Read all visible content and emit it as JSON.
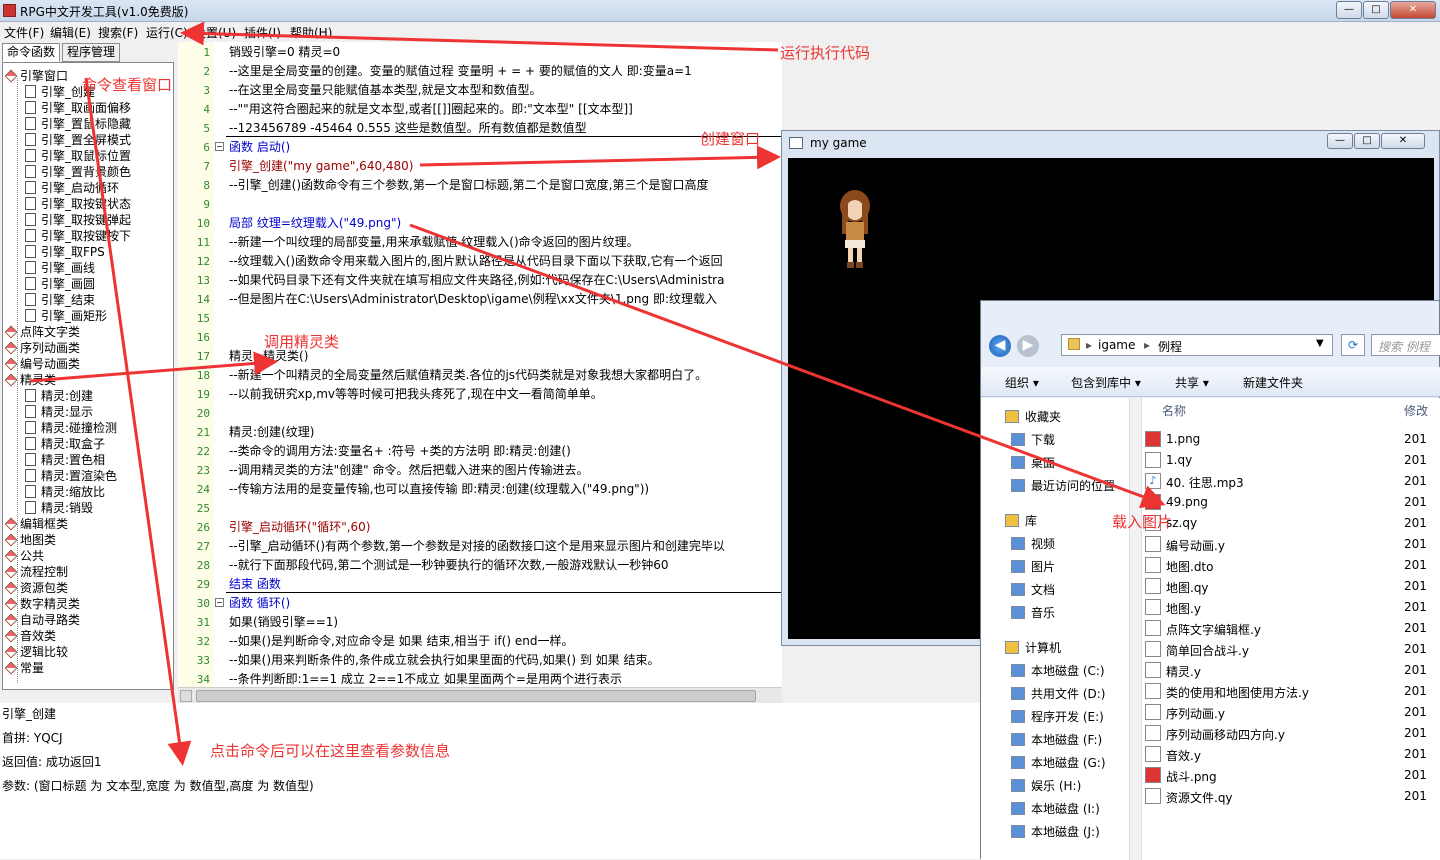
{
  "app": {
    "title": "RPG中文开发工具(v1.0免费版)"
  },
  "window_buttons": {
    "minimize": "—",
    "maximize": "□",
    "close": "✕"
  },
  "menu": [
    "文件(F)",
    "编辑(E)",
    "搜索(F)",
    "运行(C)",
    "设置(U)",
    "插件(I)",
    "帮助(H)"
  ],
  "tabs": [
    "命令函数",
    "程序管理"
  ],
  "tree": [
    {
      "label": "引擎窗口",
      "level": 0
    },
    {
      "label": "引擎_创建",
      "level": 1
    },
    {
      "label": "引擎_取画面偏移",
      "level": 1
    },
    {
      "label": "引擎_置鼠标隐藏",
      "level": 1
    },
    {
      "label": "引擎_置全屏模式",
      "level": 1
    },
    {
      "label": "引擎_取鼠标位置",
      "level": 1
    },
    {
      "label": "引擎_置背景颜色",
      "level": 1
    },
    {
      "label": "引擎_启动循环",
      "level": 1
    },
    {
      "label": "引擎_取按键状态",
      "level": 1
    },
    {
      "label": "引擎_取按键弹起",
      "level": 1
    },
    {
      "label": "引擎_取按键按下",
      "level": 1
    },
    {
      "label": "引擎_取FPS",
      "level": 1
    },
    {
      "label": "引擎_画线",
      "level": 1
    },
    {
      "label": "引擎_画圆",
      "level": 1
    },
    {
      "label": "引擎_结束",
      "level": 1
    },
    {
      "label": "引擎_画矩形",
      "level": 1
    },
    {
      "label": "点阵文字类",
      "level": 0
    },
    {
      "label": "序列动画类",
      "level": 0
    },
    {
      "label": "编号动画类",
      "level": 0
    },
    {
      "label": "精灵类",
      "level": 0
    },
    {
      "label": "精灵:创建",
      "level": 1
    },
    {
      "label": "精灵:显示",
      "level": 1
    },
    {
      "label": "精灵:碰撞检测",
      "level": 1
    },
    {
      "label": "精灵:取盒子",
      "level": 1
    },
    {
      "label": "精灵:置色相",
      "level": 1
    },
    {
      "label": "精灵:置渲染色",
      "level": 1
    },
    {
      "label": "精灵:缩放比",
      "level": 1
    },
    {
      "label": "精灵:销毁",
      "level": 1
    },
    {
      "label": "编辑框类",
      "level": 0
    },
    {
      "label": "地图类",
      "level": 0
    },
    {
      "label": "公共",
      "level": 0
    },
    {
      "label": "流程控制",
      "level": 0
    },
    {
      "label": "资源包类",
      "level": 0
    },
    {
      "label": "数字精灵类",
      "level": 0
    },
    {
      "label": "自动寻路类",
      "level": 0
    },
    {
      "label": "音效类",
      "level": 0
    },
    {
      "label": "逻辑比较",
      "level": 0
    },
    {
      "label": "常量",
      "level": 0
    }
  ],
  "code": [
    "销毁引擎=0 精灵=0",
    "--这里是全局变量的创建。变量的赋值过程 变量明 + = + 要的赋值的文人 即:变量a=1",
    "--在这里全局变量只能赋值基本类型,就是文本型和数值型。",
    "--\"\"用这符合圈起来的就是文本型,或者[[]]圈起来的。即:\"文本型\" [[文本型]]",
    "--123456789 -45464 0.555 这些是数值型。所有数值都是数值型",
    "函数 启动()",
    "引擎_创建(\"my game\",640,480)",
    "--引擎_创建()函数命令有三个参数,第一个是窗口标题,第二个是窗口宽度,第三个是窗口高度",
    "",
    "局部 纹理=纹理载入(\"49.png\")",
    "--新建一个叫纹理的局部变量,用来承载赋值 纹理载入()命令返回的图片纹理。",
    "--纹理载入()函数命令用来载入图片的,图片默认路径是从代码目录下面以下获取,它有一个返回",
    "--如果代码目录下还有文件夹就在填写相应文件夹路径,例如:代码保存在C:\\Users\\Administra",
    "--但是图片在C:\\Users\\Administrator\\Desktop\\igame\\例程\\xx文件夹\\1.png  即:纹理载入",
    "",
    "",
    "精灵=精灵类()",
    "--新建一个叫精灵的全局变量然后赋值精灵类.各位的js代码类就是对象我想大家都明白了。",
    "--以前我研究xp,mv等等时候可把我头疼死了,现在中文一看简简单单。",
    "",
    "精灵:创建(纹理)",
    "--类命令的调用方法:变量名+ :符号 +类的方法明 即:精灵:创建()",
    "--调用精灵类的方法\"创建\" 命令。然后把载入进来的图片传输进去。",
    "--传输方法用的是变量传输,也可以直接传输 即:精灵:创建(纹理载入(\"49.png\"))",
    "",
    "引擎_启动循环(\"循环\",60)",
    "--引擎_启动循环()有两个参数,第一个参数是对接的函数接口这个是用来显示图片和创建完毕以",
    "--就行下面那段代码,第二个测试是一秒钟要执行的循环次数,一般游戏默认一秒钟60",
    "结束 函数",
    "函数 循环()",
    "    如果(销毁引擎==1)",
    "     --如果()是判断命令,对应命令是 如果 结束,相当于 if() end一样。",
    "     --如果()用来判断条件的,条件成立就会执行如果里面的代码,如果() 到 如果 结束。",
    "     --条件判断即:1==1 成立  2==1不成立 如果里面两个=是用两个进行表示"
  ],
  "info": {
    "name": "引擎_创建",
    "pinyin": "首拼: YQCJ",
    "returns": "返回值: 成功返回1",
    "params": "参数: (窗口标题 为 文本型,宽度 为 数值型,高度 为 数值型)"
  },
  "game_window": {
    "title": "my game"
  },
  "explorer": {
    "path": [
      "igame",
      "例程"
    ],
    "search_placeholder": "搜索 例程",
    "toolbar": [
      "组织 ▾",
      "包含到库中 ▾",
      "共享 ▾",
      "新建文件夹"
    ],
    "column_name": "名称",
    "column_date": "修改",
    "nav": [
      {
        "label": "收藏夹",
        "group": true
      },
      {
        "label": "下载"
      },
      {
        "label": "桌面"
      },
      {
        "label": "最近访问的位置"
      },
      {
        "label": "库",
        "group": true
      },
      {
        "label": "视频"
      },
      {
        "label": "图片"
      },
      {
        "label": "文档"
      },
      {
        "label": "音乐"
      },
      {
        "label": "计算机",
        "group": true
      },
      {
        "label": "本地磁盘 (C:)"
      },
      {
        "label": "共用文件 (D:)"
      },
      {
        "label": "程序开发 (E:)"
      },
      {
        "label": "本地磁盘 (F:)"
      },
      {
        "label": "本地磁盘 (G:)"
      },
      {
        "label": "娱乐 (H:)"
      },
      {
        "label": "本地磁盘 (I:)"
      },
      {
        "label": "本地磁盘 (J:)"
      }
    ],
    "files": [
      {
        "name": "1.png",
        "type": "png",
        "date": "201"
      },
      {
        "name": "1.qy",
        "type": "doc",
        "date": "201"
      },
      {
        "name": "40. 往思.mp3",
        "type": "music",
        "date": "201"
      },
      {
        "name": "49.png",
        "type": "png",
        "date": "201"
      },
      {
        "name": "sz.qy",
        "type": "doc",
        "date": "201"
      },
      {
        "name": "编号动画.y",
        "type": "doc",
        "date": "201"
      },
      {
        "name": "地图.dto",
        "type": "doc",
        "date": "201"
      },
      {
        "name": "地图.qy",
        "type": "doc",
        "date": "201"
      },
      {
        "name": "地图.y",
        "type": "doc",
        "date": "201"
      },
      {
        "name": "点阵文字编辑框.y",
        "type": "doc",
        "date": "201"
      },
      {
        "name": "简单回合战斗.y",
        "type": "doc",
        "date": "201"
      },
      {
        "name": "精灵.y",
        "type": "doc",
        "date": "201"
      },
      {
        "name": "类的使用和地图使用方法.y",
        "type": "doc",
        "date": "201"
      },
      {
        "name": "序列动画.y",
        "type": "doc",
        "date": "201"
      },
      {
        "name": "序列动画移动四方向.y",
        "type": "doc",
        "date": "201"
      },
      {
        "name": "音效.y",
        "type": "doc",
        "date": "201"
      },
      {
        "name": "战斗.png",
        "type": "png",
        "date": "201"
      },
      {
        "name": "资源文件.qy",
        "type": "doc",
        "date": "201"
      }
    ]
  },
  "annotations": {
    "run": "运行执行代码",
    "cmd_window": "命令查看窗口",
    "create_window": "创建窗口",
    "call_sprite": "调用精灵类",
    "load_image": "载入图片",
    "param_info": "点击命令后可以在这里查看参数信息"
  },
  "colors": {
    "annotation": "#e33",
    "keyword": "#0000cc",
    "string": "#aa00aa",
    "line_number": "#2f8a2f"
  }
}
